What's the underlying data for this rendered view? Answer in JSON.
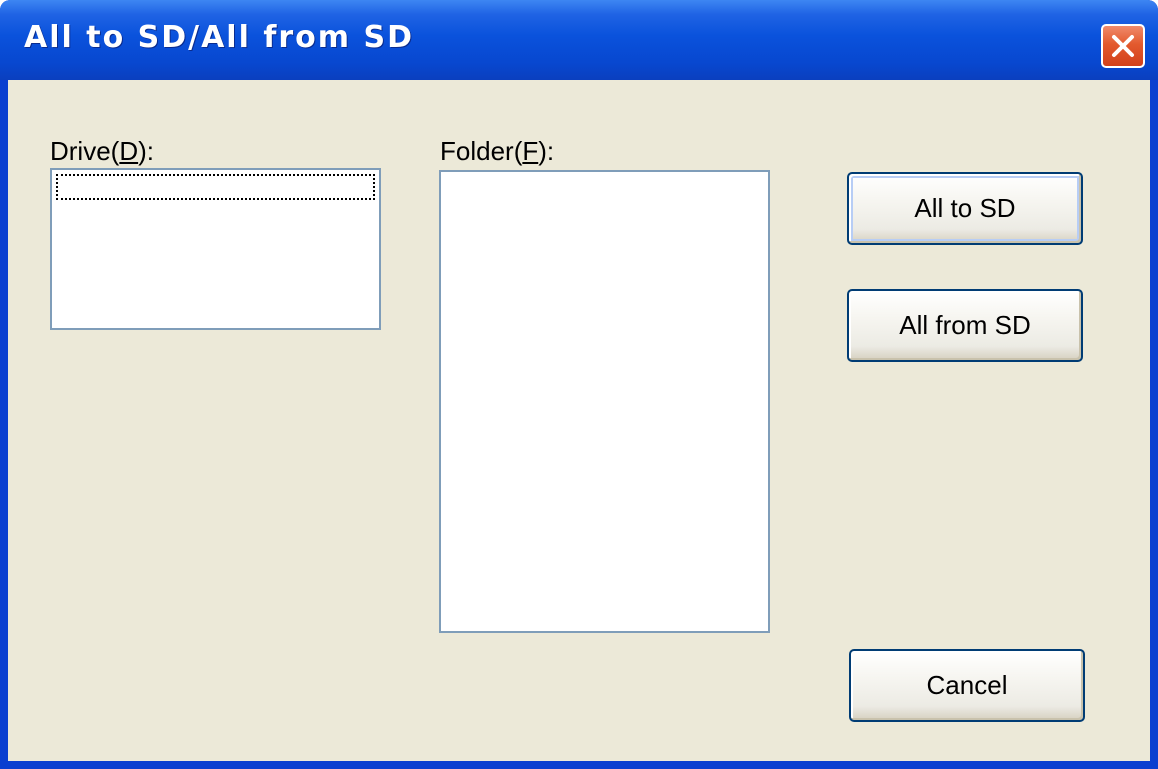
{
  "window": {
    "title": "All to SD/All from SD",
    "close_icon": "close-icon"
  },
  "drive": {
    "label_prefix": "Drive(",
    "label_accel": "D",
    "label_suffix": "):",
    "items": []
  },
  "folder": {
    "label_prefix": "Folder(",
    "label_accel": "F",
    "label_suffix": "):",
    "items": []
  },
  "buttons": {
    "all_to_sd": "All to SD",
    "all_from_sd": "All from SD",
    "cancel": "Cancel"
  },
  "colors": {
    "titlebar": "#0a52dc",
    "face": "#ece9d8",
    "close_button": "#e35a2e",
    "listbox_border": "#7f9db9",
    "button_border": "#003c74"
  }
}
